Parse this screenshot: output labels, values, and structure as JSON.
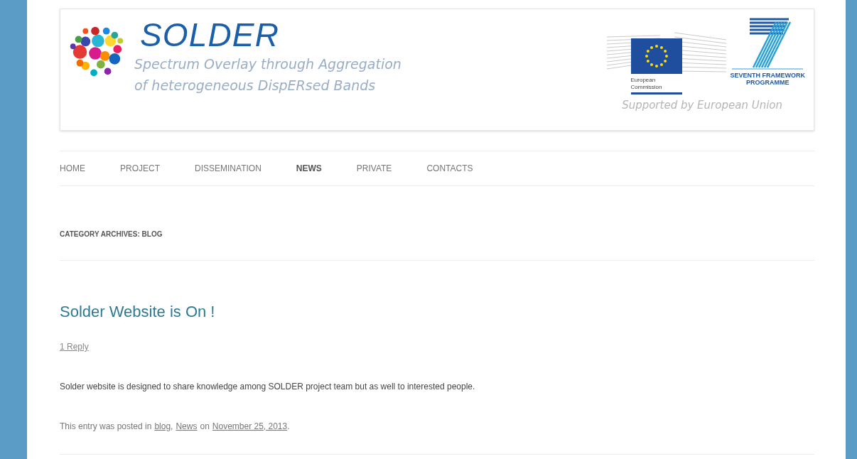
{
  "header": {
    "title": "SOLDER",
    "subtitle_lines": [
      "Spectrum Overlay through Aggregation",
      "of heterogeneous DispERsed Bands"
    ],
    "ec_label_lines": [
      "European",
      "Commission"
    ],
    "fp7_label_lines": [
      "SEVENTH FRAMEWORK",
      "PROGRAMME"
    ],
    "support_text": "Supported by European Union"
  },
  "nav": [
    {
      "label": "HOME",
      "selected": false
    },
    {
      "label": "PROJECT",
      "selected": false
    },
    {
      "label": "DISSEMINATION",
      "selected": false
    },
    {
      "label": "NEWS",
      "selected": true
    },
    {
      "label": "PRIVATE",
      "selected": false
    },
    {
      "label": "CONTACTS",
      "selected": false
    }
  ],
  "archive_title": "CATEGORY ARCHIVES: BLOG",
  "post": {
    "title": "Solder Website is On !",
    "reply_link": "1 Reply",
    "body": "Solder website is designed to share knowledge among SOLDER project team but as well to interested people.",
    "meta": [
      {
        "kind": "text",
        "text": "This entry was posted in"
      },
      {
        "kind": "link",
        "text": "blog"
      },
      {
        "kind": "text",
        "text": ","
      },
      {
        "kind": "link",
        "text": "News"
      },
      {
        "kind": "text",
        "text": "on"
      },
      {
        "kind": "link",
        "text": "November 25, 2013"
      },
      {
        "kind": "text",
        "text": "."
      }
    ]
  }
}
